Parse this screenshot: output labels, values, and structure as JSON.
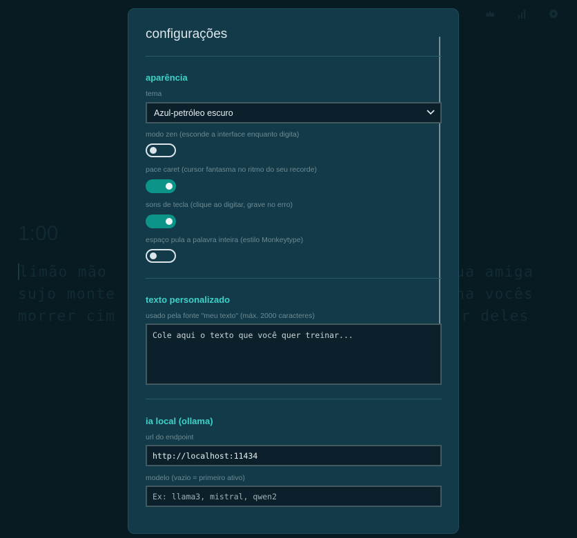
{
  "background": {
    "timer": "1:00",
    "text_lines": [
      "limão mão",
      "sujo monte",
      "morrer cim"
    ],
    "text_right": [
      "tua amiga",
      "nha vocês",
      "r deles"
    ],
    "nav_icons": [
      "crown-icon",
      "stats-icon",
      "gear-icon"
    ]
  },
  "modal": {
    "title": "configurações",
    "appearance": {
      "title": "aparência",
      "theme_label": "tema",
      "theme_value": "Azul-petróleo escuro",
      "zen_label": "modo zen (esconde a interface enquanto digita)",
      "zen_on": false,
      "pace_label": "pace caret (cursor fantasma no ritmo do seu recorde)",
      "pace_on": true,
      "sounds_label": "sons de tecla (clique ao digitar, grave no erro)",
      "sounds_on": true,
      "space_label": "espaço pula a palavra inteira (estilo Monkeytype)",
      "space_on": false
    },
    "custom_text": {
      "title": "texto personalizado",
      "label": "usado pela fonte \"meu texto\" (máx. 2000 caracteres)",
      "placeholder": "Cole aqui o texto que você quer treinar..."
    },
    "local_ai": {
      "title": "ia local (ollama)",
      "endpoint_label": "url do endpoint",
      "endpoint_value": "http://localhost:11434",
      "model_label": "modelo (vazio = primeiro ativo)",
      "model_placeholder": "Ex: llama3, mistral, qwen2"
    }
  },
  "colors": {
    "accent": "#3fd1c7",
    "toggle_on": "#0d9488",
    "modal_bg": "#123a48",
    "page_bg": "#0a1e27"
  }
}
